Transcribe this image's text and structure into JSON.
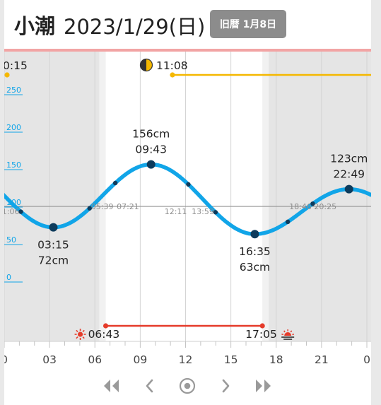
{
  "header": {
    "tide_type": "小潮",
    "date": "2023/1/29(日)",
    "lunar_badge": "旧暦 1月8日"
  },
  "moon": {
    "icon": "half-moon-icon",
    "prev_time_fragment": "0:15",
    "moonrise": "11:08"
  },
  "sun": {
    "sunrise": "06:43",
    "sunset": "17:05",
    "sunrise_icon": "sunrise-icon",
    "sunset_icon": "sunset-icon"
  },
  "colors": {
    "tide_curve": "#11a5e8",
    "moon_line": "#f5b800",
    "sun_line": "#e53b2a",
    "night_shade": "#e5e5e5",
    "axis_label": "#11a5e8"
  },
  "chart_data": {
    "type": "line",
    "title": "",
    "xlabel": "",
    "ylabel": "",
    "x_unit": "hour",
    "y_unit": "cm",
    "xlim": [
      0,
      24
    ],
    "ylim": [
      -45,
      275
    ],
    "x_ticks": [
      0,
      3,
      6,
      9,
      12,
      15,
      18,
      21,
      24
    ],
    "x_tick_labels": [
      "0",
      "03",
      "06",
      "09",
      "12",
      "15",
      "18",
      "21",
      "0"
    ],
    "y_ticks": [
      0,
      50,
      100,
      150,
      200,
      250
    ],
    "y_tick_labels": [
      "0",
      "50",
      "100",
      "150",
      "200",
      "250"
    ],
    "reference_level": 100,
    "extremes": [
      {
        "time": "03:15",
        "hour": 3.25,
        "height": 72,
        "label_height": "72cm",
        "kind": "low"
      },
      {
        "time": "09:43",
        "hour": 9.717,
        "height": 156,
        "label_height": "156cm",
        "kind": "high"
      },
      {
        "time": "16:35",
        "hour": 16.583,
        "height": 63,
        "label_height": "63cm",
        "kind": "low"
      },
      {
        "time": "22:49",
        "hour": 22.817,
        "height": 123,
        "label_height": "123cm",
        "kind": "high"
      }
    ],
    "crossings": [
      {
        "time": "01:06",
        "hour": 1.1
      },
      {
        "time": "05:39",
        "hour": 5.65
      },
      {
        "time": "07:21",
        "hour": 7.35
      },
      {
        "time": "12:11",
        "hour": 12.183
      },
      {
        "time": "13:59",
        "hour": 13.983
      },
      {
        "time": "18:46",
        "hour": 18.767
      },
      {
        "time": "20:25",
        "hour": 20.417
      }
    ],
    "day_start": 6.717,
    "day_end": 17.083,
    "twilight_minutes": 25,
    "moonrise_hour": 11.133
  },
  "nav": {
    "prev_week_icon": "double-chevron-left-icon",
    "prev_day_icon": "chevron-left-icon",
    "today_icon": "target-circle-icon",
    "next_day_icon": "chevron-right-icon",
    "next_week_icon": "double-chevron-right-icon"
  }
}
